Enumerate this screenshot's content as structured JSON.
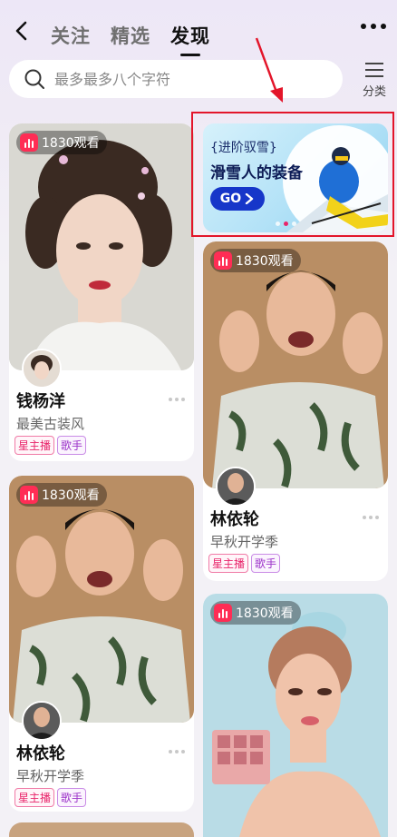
{
  "nav": {
    "tabs": [
      {
        "label": "关注",
        "active": false
      },
      {
        "label": "精选",
        "active": false
      },
      {
        "label": "发现",
        "active": true
      }
    ]
  },
  "search": {
    "placeholder": "最多最多八个字符"
  },
  "category": {
    "label": "分类"
  },
  "banner": {
    "subtitle": "{进阶驭雪}",
    "title": "滑雪人的装备",
    "button_label": "GO",
    "slides": 3,
    "active_slide": 2
  },
  "cards": [
    {
      "viewers": "1830观看",
      "name": "钱杨洋",
      "desc": "最美古装风",
      "tags": [
        "星主播",
        "歌手"
      ]
    },
    {
      "viewers": "1830观看",
      "name": "林依轮",
      "desc": "早秋开学季",
      "tags": [
        "星主播",
        "歌手"
      ]
    },
    {
      "viewers": "1830观看",
      "name": "林依轮",
      "desc": "早秋开学季",
      "tags": [
        "星主播",
        "歌手"
      ]
    },
    {
      "viewers": "1830观看"
    }
  ],
  "colors": {
    "live_badge": "#ff2d55",
    "tag_pink": "#e8246a",
    "tag_purple": "#9b30c8",
    "annotation_red": "#e3152a",
    "go_button": "#1636c9"
  }
}
